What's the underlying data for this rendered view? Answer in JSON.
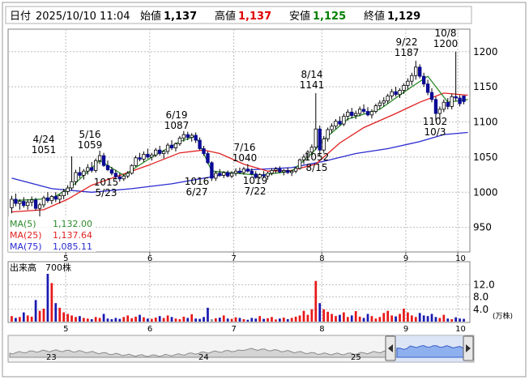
{
  "header": {
    "date_label": "日付",
    "datetime": "2025/10/10 11:04",
    "open_label": "始値",
    "open_value": "1,137",
    "high_label": "高値",
    "high_value": "1,137",
    "low_label": "安値",
    "low_value": "1,125",
    "close_label": "終値",
    "close_value": "1,129"
  },
  "legend": {
    "ma5": "MA(5)",
    "ma5_value": "1,132.00",
    "ma25": "MA(25)",
    "ma25_value": "1,137.64",
    "ma75": "MA(75)",
    "ma75_value": "1,085.11"
  },
  "volume_panel": {
    "title": "出来高　700株",
    "unit": "(万株)"
  },
  "colors": {
    "up": "#ffffff",
    "down": "#0a0a96",
    "ma5": "#2c8a2c",
    "ma25": "#e02020",
    "ma75": "#2a2ad0",
    "vol_up": "#e81818",
    "vol_down": "#1a1ab0",
    "high_text": "#e00000",
    "low_text": "#008000"
  },
  "navigator": {
    "labels": [
      "23",
      "24",
      "25"
    ]
  },
  "chart_data": [
    {
      "type": "candlestick",
      "y_ticks": [
        950,
        1000,
        1050,
        1100,
        1150,
        1200
      ],
      "ylim": [
        915,
        1232
      ],
      "x_ticks": [
        "5",
        "6",
        "7",
        "8",
        "9",
        "10"
      ],
      "annotations": [
        {
          "date": "4/24",
          "value": 1051,
          "kind": "high"
        },
        {
          "date": "5/16",
          "value": 1059,
          "kind": "high"
        },
        {
          "date": "5/23",
          "value": 1015,
          "kind": "low"
        },
        {
          "date": "6/19",
          "value": 1087,
          "kind": "high"
        },
        {
          "date": "6/27",
          "value": 1016,
          "kind": "low"
        },
        {
          "date": "7/16",
          "value": 1040,
          "kind": "high"
        },
        {
          "date": "7/22",
          "value": 1019,
          "kind": "low"
        },
        {
          "date": "8/14",
          "value": 1141,
          "kind": "high"
        },
        {
          "date": "8/15",
          "value": 1052,
          "kind": "low"
        },
        {
          "date": "9/22",
          "value": 1187,
          "kind": "high"
        },
        {
          "date": "10/8",
          "value": 1200,
          "kind": "high"
        },
        {
          "date": "10/3",
          "value": 1102,
          "kind": "low"
        }
      ],
      "candles": [
        [
          978,
          995,
          970,
          990
        ],
        [
          990,
          998,
          980,
          984
        ],
        [
          984,
          990,
          975,
          987
        ],
        [
          987,
          993,
          978,
          981
        ],
        [
          981,
          990,
          975,
          986
        ],
        [
          986,
          994,
          980,
          989
        ],
        [
          989,
          992,
          974,
          977
        ],
        [
          977,
          985,
          965,
          982
        ],
        [
          982,
          995,
          978,
          992
        ],
        [
          992,
          1000,
          985,
          988
        ],
        [
          988,
          996,
          983,
          994
        ],
        [
          994,
          1000,
          986,
          990
        ],
        [
          990,
          997,
          984,
          995
        ],
        [
          995,
          1005,
          990,
          1001
        ],
        [
          1001,
          1010,
          996,
          1006
        ],
        [
          1006,
          1051,
          1003,
          1015
        ],
        [
          1015,
          1032,
          1010,
          1028
        ],
        [
          1028,
          1036,
          1020,
          1024
        ],
        [
          1024,
          1033,
          1018,
          1030
        ],
        [
          1030,
          1040,
          1025,
          1035
        ],
        [
          1035,
          1043,
          1028,
          1031
        ],
        [
          1031,
          1048,
          1028,
          1045
        ],
        [
          1045,
          1059,
          1040,
          1052
        ],
        [
          1052,
          1056,
          1036,
          1038
        ],
        [
          1038,
          1045,
          1030,
          1032
        ],
        [
          1032,
          1036,
          1024,
          1027
        ],
        [
          1027,
          1032,
          1018,
          1022
        ],
        [
          1022,
          1027,
          1015,
          1019
        ],
        [
          1019,
          1025,
          1016,
          1023
        ],
        [
          1023,
          1030,
          1020,
          1027
        ],
        [
          1027,
          1040,
          1025,
          1038
        ],
        [
          1038,
          1052,
          1036,
          1049
        ],
        [
          1049,
          1056,
          1044,
          1047
        ],
        [
          1047,
          1058,
          1043,
          1054
        ],
        [
          1054,
          1062,
          1048,
          1050
        ],
        [
          1050,
          1056,
          1045,
          1053
        ],
        [
          1053,
          1063,
          1050,
          1060
        ],
        [
          1060,
          1066,
          1052,
          1055
        ],
        [
          1055,
          1060,
          1048,
          1058
        ],
        [
          1058,
          1070,
          1054,
          1067
        ],
        [
          1067,
          1074,
          1060,
          1063
        ],
        [
          1063,
          1071,
          1058,
          1069
        ],
        [
          1069,
          1080,
          1066,
          1077
        ],
        [
          1077,
          1087,
          1072,
          1082
        ],
        [
          1082,
          1086,
          1074,
          1078
        ],
        [
          1078,
          1084,
          1072,
          1081
        ],
        [
          1081,
          1085,
          1070,
          1074
        ],
        [
          1074,
          1078,
          1060,
          1062
        ],
        [
          1062,
          1066,
          1052,
          1055
        ],
        [
          1055,
          1058,
          1040,
          1042
        ],
        [
          1042,
          1044,
          1016,
          1020
        ],
        [
          1020,
          1030,
          1016,
          1027
        ],
        [
          1027,
          1033,
          1022,
          1024
        ],
        [
          1024,
          1030,
          1020,
          1028
        ],
        [
          1028,
          1031,
          1021,
          1023
        ],
        [
          1023,
          1030,
          1020,
          1027
        ],
        [
          1027,
          1034,
          1023,
          1030
        ],
        [
          1030,
          1035,
          1026,
          1028
        ],
        [
          1028,
          1036,
          1025,
          1033
        ],
        [
          1033,
          1040,
          1028,
          1030
        ],
        [
          1030,
          1034,
          1024,
          1026
        ],
        [
          1026,
          1030,
          1019,
          1021
        ],
        [
          1021,
          1027,
          1019,
          1025
        ],
        [
          1025,
          1030,
          1020,
          1023
        ],
        [
          1023,
          1029,
          1018,
          1027
        ],
        [
          1027,
          1034,
          1024,
          1031
        ],
        [
          1031,
          1036,
          1027,
          1033
        ],
        [
          1033,
          1037,
          1027,
          1029
        ],
        [
          1029,
          1033,
          1024,
          1031
        ],
        [
          1031,
          1035,
          1026,
          1028
        ],
        [
          1028,
          1032,
          1023,
          1030
        ],
        [
          1030,
          1036,
          1027,
          1034
        ],
        [
          1034,
          1048,
          1032,
          1046
        ],
        [
          1046,
          1054,
          1040,
          1050
        ],
        [
          1050,
          1060,
          1045,
          1057
        ],
        [
          1057,
          1068,
          1052,
          1064
        ],
        [
          1064,
          1141,
          1060,
          1090
        ],
        [
          1090,
          1095,
          1052,
          1060
        ],
        [
          1060,
          1080,
          1056,
          1076
        ],
        [
          1076,
          1092,
          1072,
          1089
        ],
        [
          1089,
          1098,
          1084,
          1094
        ],
        [
          1094,
          1104,
          1090,
          1101
        ],
        [
          1101,
          1108,
          1095,
          1097
        ],
        [
          1097,
          1112,
          1094,
          1108
        ],
        [
          1108,
          1118,
          1102,
          1114
        ],
        [
          1114,
          1120,
          1105,
          1109
        ],
        [
          1109,
          1116,
          1104,
          1112
        ],
        [
          1112,
          1122,
          1108,
          1118
        ],
        [
          1118,
          1125,
          1112,
          1115
        ],
        [
          1115,
          1121,
          1108,
          1110
        ],
        [
          1110,
          1118,
          1105,
          1115
        ],
        [
          1115,
          1126,
          1112,
          1123
        ],
        [
          1123,
          1131,
          1118,
          1127
        ],
        [
          1127,
          1135,
          1122,
          1130
        ],
        [
          1130,
          1140,
          1126,
          1137
        ],
        [
          1137,
          1147,
          1132,
          1143
        ],
        [
          1143,
          1150,
          1136,
          1139
        ],
        [
          1139,
          1148,
          1134,
          1145
        ],
        [
          1145,
          1155,
          1140,
          1152
        ],
        [
          1152,
          1162,
          1146,
          1158
        ],
        [
          1158,
          1170,
          1152,
          1166
        ],
        [
          1166,
          1187,
          1160,
          1178
        ],
        [
          1178,
          1182,
          1162,
          1165
        ],
        [
          1165,
          1170,
          1150,
          1154
        ],
        [
          1154,
          1160,
          1138,
          1142
        ],
        [
          1142,
          1148,
          1128,
          1132
        ],
        [
          1132,
          1136,
          1102,
          1112
        ],
        [
          1112,
          1122,
          1104,
          1118
        ],
        [
          1118,
          1132,
          1114,
          1128
        ],
        [
          1128,
          1134,
          1118,
          1122
        ],
        [
          1122,
          1140,
          1118,
          1136
        ],
        [
          1136,
          1200,
          1130,
          1134
        ],
        [
          1134,
          1138,
          1122,
          1126
        ],
        [
          1137,
          1137,
          1125,
          1129
        ]
      ],
      "ma": {
        "ma5": [
          [
            0,
            988
          ],
          [
            10,
            991
          ],
          [
            15,
            1008
          ],
          [
            22,
            1045
          ],
          [
            28,
            1024
          ],
          [
            35,
            1050
          ],
          [
            42,
            1072
          ],
          [
            46,
            1080
          ],
          [
            50,
            1030
          ],
          [
            56,
            1027
          ],
          [
            62,
            1024
          ],
          [
            70,
            1030
          ],
          [
            75,
            1055
          ],
          [
            78,
            1075
          ],
          [
            84,
            1104
          ],
          [
            92,
            1118
          ],
          [
            100,
            1150
          ],
          [
            104,
            1165
          ],
          [
            109,
            1128
          ],
          [
            114,
            1132
          ]
        ],
        "ma25": [
          [
            0,
            972
          ],
          [
            8,
            975
          ],
          [
            14,
            990
          ],
          [
            20,
            1010
          ],
          [
            26,
            1022
          ],
          [
            34,
            1038
          ],
          [
            42,
            1056
          ],
          [
            48,
            1060
          ],
          [
            52,
            1055
          ],
          [
            58,
            1040
          ],
          [
            64,
            1030
          ],
          [
            70,
            1031
          ],
          [
            76,
            1040
          ],
          [
            82,
            1070
          ],
          [
            88,
            1092
          ],
          [
            96,
            1112
          ],
          [
            102,
            1128
          ],
          [
            108,
            1141
          ],
          [
            114,
            1138
          ]
        ],
        "ma75": [
          [
            0,
            1020
          ],
          [
            10,
            1005
          ],
          [
            20,
            1000
          ],
          [
            30,
            1005
          ],
          [
            40,
            1012
          ],
          [
            50,
            1022
          ],
          [
            60,
            1032
          ],
          [
            70,
            1035
          ],
          [
            78,
            1044
          ],
          [
            86,
            1055
          ],
          [
            94,
            1062
          ],
          [
            102,
            1072
          ],
          [
            108,
            1082
          ],
          [
            114,
            1085
          ]
        ]
      }
    },
    {
      "type": "bar",
      "name": "volume",
      "y_ticks": [
        4.0,
        8.0,
        12.0
      ],
      "ylim": [
        0,
        15.5
      ],
      "values": [
        1.8,
        1.2,
        1.5,
        3.0,
        2.0,
        1.6,
        7.0,
        3.5,
        4.2,
        15.5,
        12.5,
        6.0,
        4.5,
        3.0,
        2.5,
        2.0,
        1.5,
        1.8,
        1.2,
        1.0,
        0.8,
        1.5,
        1.2,
        2.5,
        1.0,
        0.8,
        1.2,
        0.9,
        1.5,
        2.0,
        1.1,
        1.6,
        2.2,
        1.4,
        1.0,
        0.9,
        1.3,
        1.8,
        1.2,
        2.0,
        1.5,
        1.0,
        0.8,
        1.6,
        1.2,
        2.4,
        1.0,
        0.9,
        1.5,
        4.5,
        0.8,
        1.1,
        1.3,
        2.0,
        1.0,
        0.9,
        1.4,
        1.2,
        0.8,
        0.6,
        1.2,
        1.0,
        1.8,
        0.9,
        1.1,
        1.5,
        0.7,
        1.0,
        1.3,
        0.8,
        1.2,
        1.6,
        2.0,
        3.5,
        2.2,
        4.0,
        13.2,
        6.0,
        4.0,
        3.2,
        2.5,
        1.8,
        2.2,
        3.0,
        1.5,
        2.0,
        3.4,
        1.6,
        1.2,
        2.5,
        1.8,
        1.0,
        1.5,
        2.8,
        3.5,
        2.0,
        1.7,
        2.5,
        4.2,
        3.0,
        2.0,
        1.5,
        2.8,
        2.0,
        1.8,
        2.5,
        1.5,
        1.2,
        2.2,
        1.0,
        0.8,
        1.4,
        1.0,
        0.9
      ]
    }
  ]
}
